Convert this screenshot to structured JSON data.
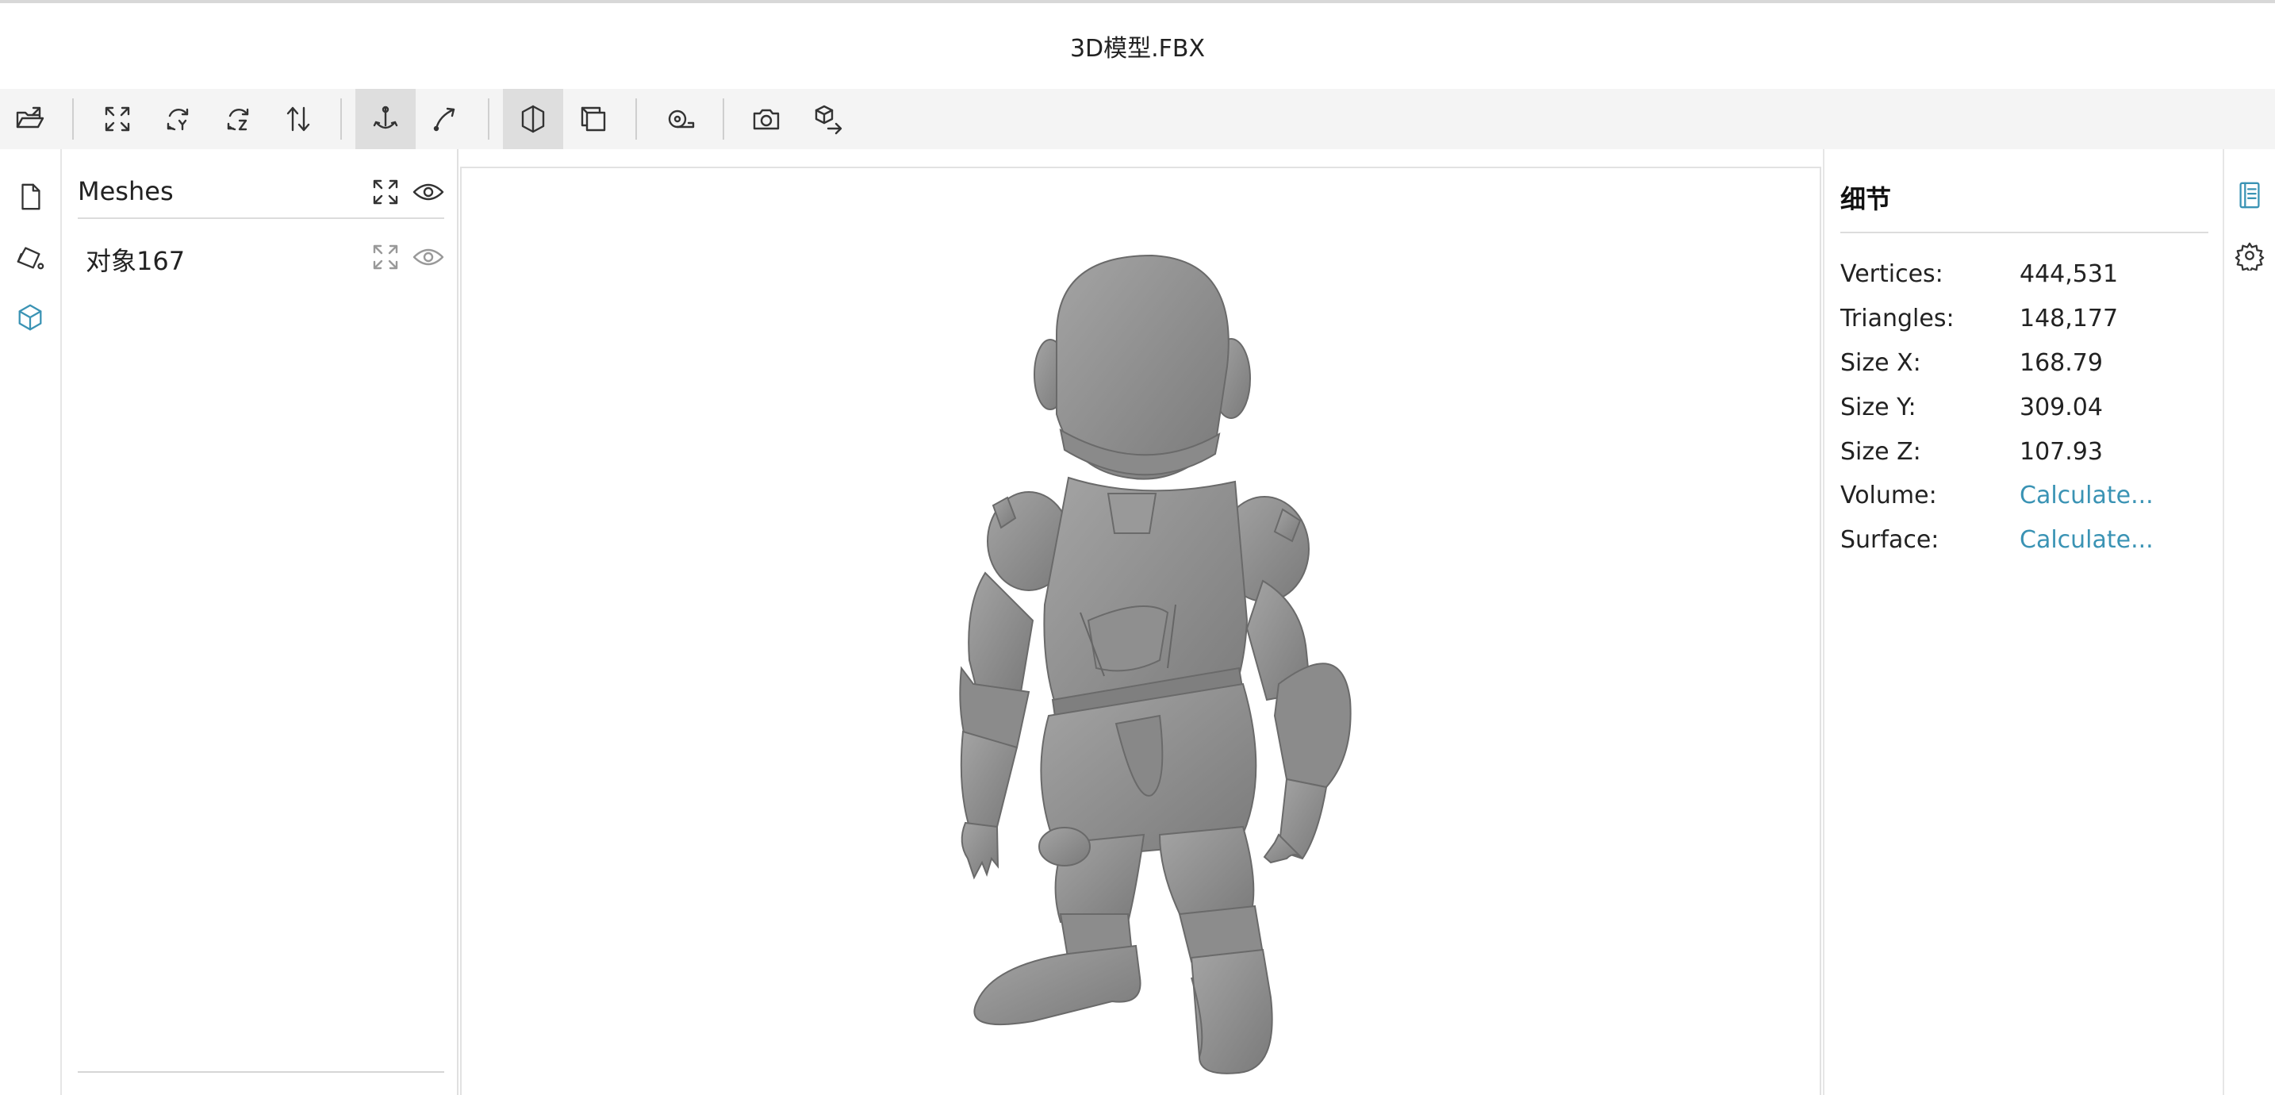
{
  "window": {
    "title": "3D模型.FBX"
  },
  "toolbar": {
    "buttons": [
      {
        "name": "open-file",
        "icon": "open-folder-icon"
      },
      {
        "name": "fit-to-window",
        "icon": "expand-icon"
      },
      {
        "name": "set-up-y",
        "icon": "rotate-y-icon"
      },
      {
        "name": "set-up-z",
        "icon": "rotate-z-icon"
      },
      {
        "name": "flip-up",
        "icon": "flip-vertical-icon"
      },
      {
        "name": "fixed-up-vector",
        "icon": "fixed-axis-icon",
        "active": true
      },
      {
        "name": "free-orbit",
        "icon": "free-orbit-icon"
      },
      {
        "name": "shading",
        "icon": "shading-icon",
        "active": true
      },
      {
        "name": "edges",
        "icon": "edges-icon"
      },
      {
        "name": "measure",
        "icon": "tape-measure-icon"
      },
      {
        "name": "snapshot",
        "icon": "camera-icon"
      },
      {
        "name": "export",
        "icon": "export-model-icon"
      }
    ]
  },
  "left_rail": {
    "items": [
      {
        "name": "files",
        "icon": "file-icon"
      },
      {
        "name": "materials",
        "icon": "materials-icon"
      },
      {
        "name": "meshes",
        "icon": "cube-icon",
        "selected": true
      }
    ]
  },
  "meshes_panel": {
    "title": "Meshes",
    "items": [
      {
        "label": "对象167"
      }
    ]
  },
  "details": {
    "title": "细节",
    "rows": [
      {
        "key": "Vertices:",
        "value": "444,531"
      },
      {
        "key": "Triangles:",
        "value": "148,177"
      },
      {
        "key": "Size X:",
        "value": "168.79"
      },
      {
        "key": "Size Y:",
        "value": "309.04"
      },
      {
        "key": "Size Z:",
        "value": "107.93"
      },
      {
        "key": "Volume:",
        "value": "Calculate...",
        "link": true
      },
      {
        "key": "Surface:",
        "value": "Calculate...",
        "link": true
      }
    ]
  },
  "right_rail": {
    "items": [
      {
        "name": "details",
        "icon": "details-icon",
        "selected": true
      },
      {
        "name": "settings",
        "icon": "gear-icon"
      }
    ]
  },
  "colors": {
    "accent": "#3a93b4",
    "model": "#8c8c8c",
    "toolbar_bg": "#f4f4f4"
  }
}
